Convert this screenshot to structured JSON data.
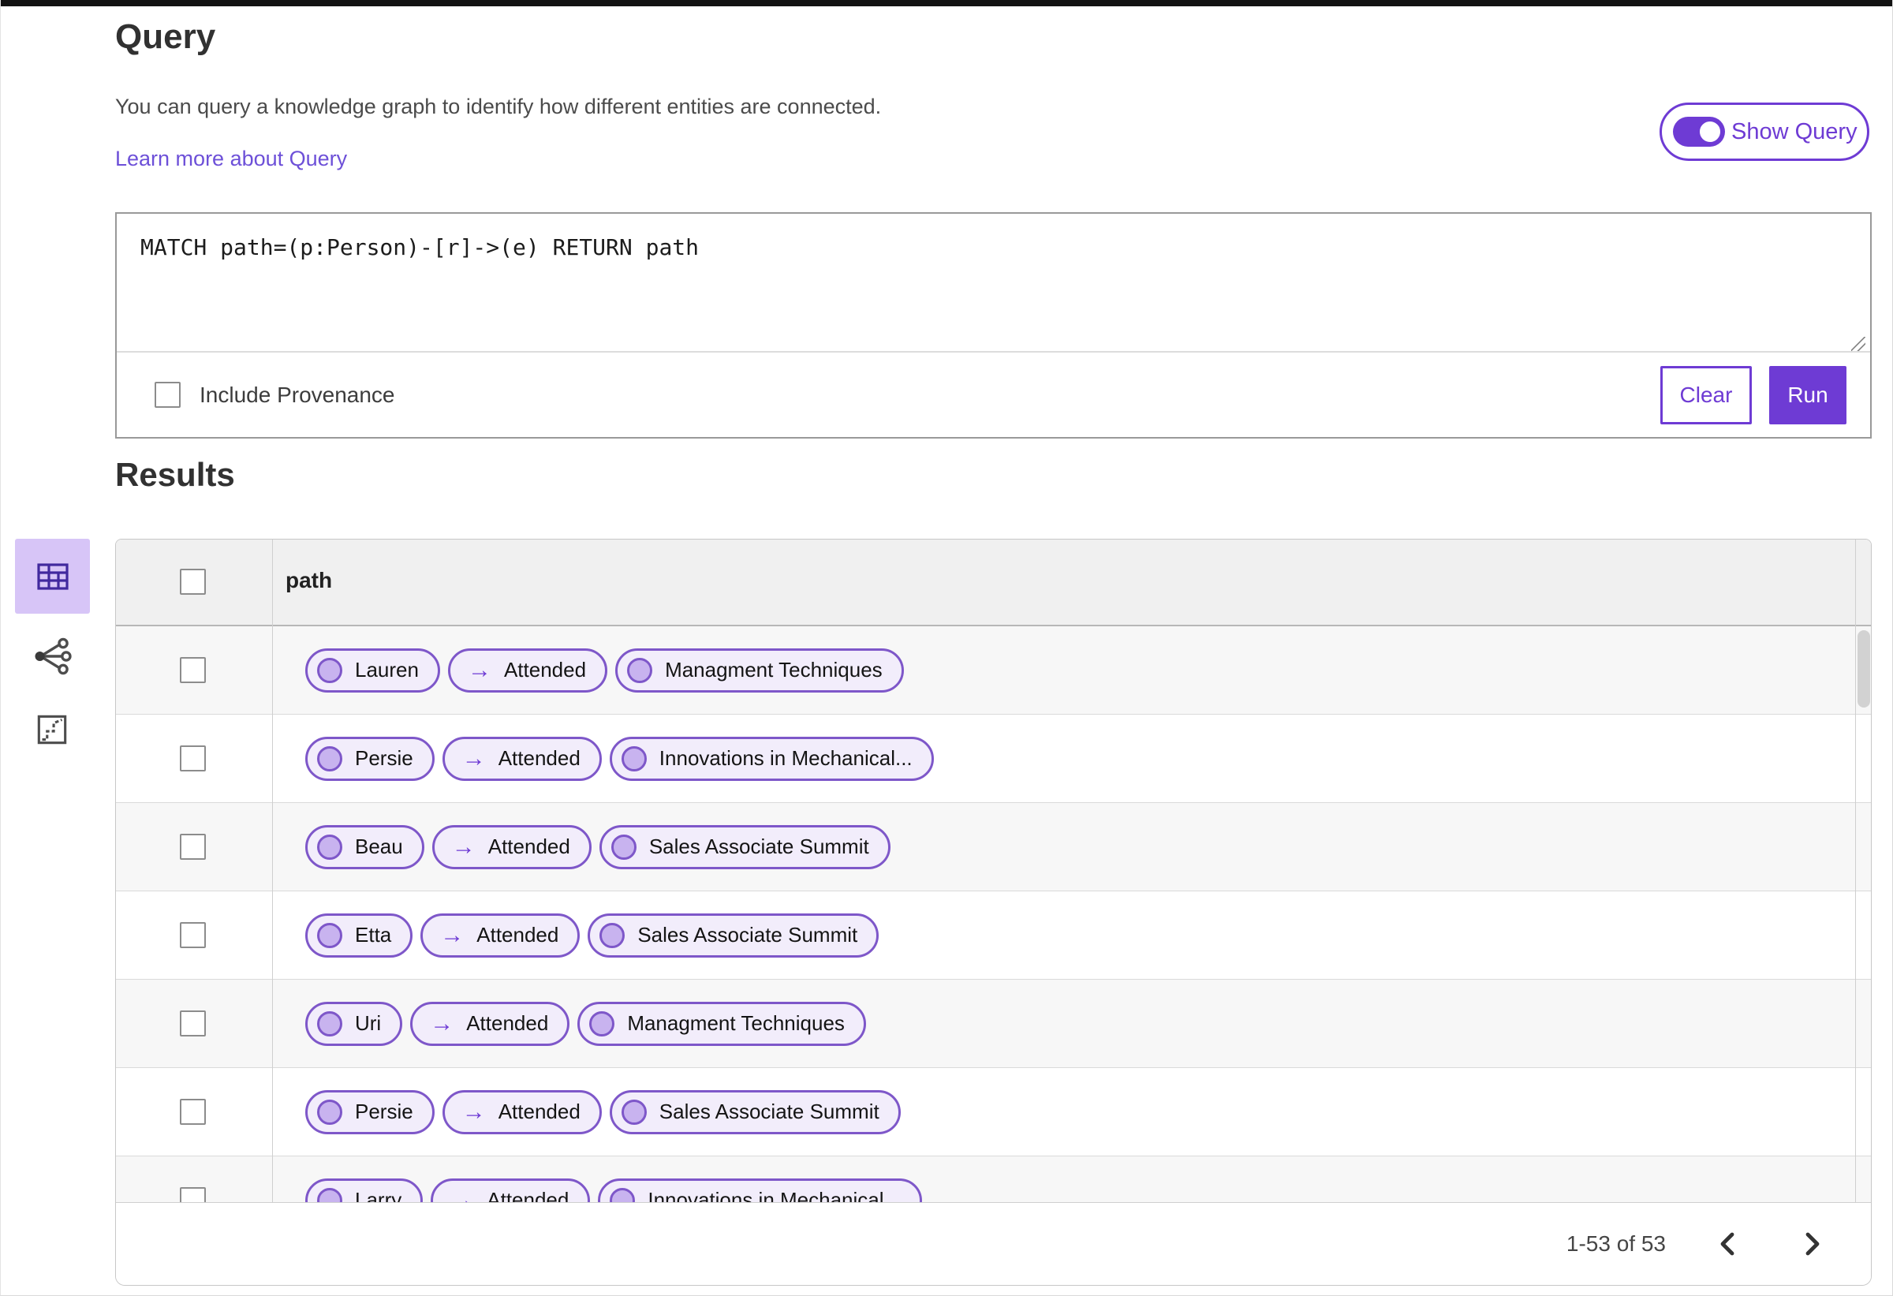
{
  "header": {
    "title": "Query",
    "description": "You can query a knowledge graph to identify how different entities are connected.",
    "learn_more_link": "Learn more about Query",
    "show_query_label": "Show Query",
    "show_query_state": "on"
  },
  "query_editor": {
    "query_text": "MATCH path=(p:Person)-[r]->(e) RETURN path",
    "include_provenance_label": "Include Provenance",
    "include_provenance_checked": false,
    "clear_button_label": "Clear",
    "run_button_label": "Run"
  },
  "results": {
    "heading": "Results",
    "view_switcher": {
      "selected": "table",
      "options": [
        "table-view",
        "graph-view",
        "chart-view"
      ]
    },
    "table": {
      "column_header": "path",
      "select_all_checked": false,
      "rows": [
        {
          "source": "Lauren",
          "edge": "Attended",
          "target": "Managment Techniques",
          "checked": false
        },
        {
          "source": "Persie",
          "edge": "Attended",
          "target": "Innovations in Mechanical...",
          "checked": false
        },
        {
          "source": "Beau",
          "edge": "Attended",
          "target": "Sales Associate Summit",
          "checked": false
        },
        {
          "source": "Etta",
          "edge": "Attended",
          "target": "Sales Associate Summit",
          "checked": false
        },
        {
          "source": "Uri",
          "edge": "Attended",
          "target": "Managment Techniques",
          "checked": false
        },
        {
          "source": "Persie",
          "edge": "Attended",
          "target": "Sales Associate Summit",
          "checked": false
        },
        {
          "source": "Larry",
          "edge": "Attended",
          "target": "Innovations in Mechanical...",
          "checked": false
        }
      ]
    },
    "pagination": {
      "range_label": "1-53 of 53"
    }
  },
  "icons": {
    "arrow_glyph": "→",
    "names": [
      "table-view-icon",
      "graph-view-icon",
      "chart-view-icon",
      "chevron-left-icon",
      "chevron-right-icon"
    ]
  },
  "colors": {
    "accent_purple": "#6e3bd4",
    "pill_border": "#7e57c9",
    "pill_background": "#f2edfb",
    "node_fill": "#c8b3ef",
    "selected_tab_background": "#d7c5f7",
    "link": "#6d50d8",
    "header_row_background": "#f0f0f0",
    "alt_row_background": "#f7f7f7"
  }
}
